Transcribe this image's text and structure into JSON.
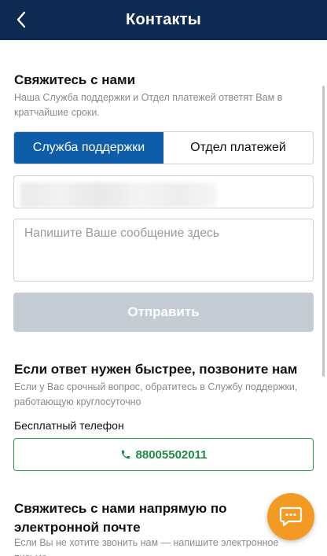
{
  "header": {
    "title": "Контакты",
    "back_icon": "chevron-left-icon"
  },
  "contact_form": {
    "title": "Свяжитесь с нами",
    "subtitle": "Наша Служба поддержки и Отдел платежей ответят Вам в кратчайшие сроки.",
    "tabs": [
      {
        "label": "Служба поддержки",
        "active": true
      },
      {
        "label": "Отдел платежей",
        "active": false
      }
    ],
    "message_placeholder": "Напишите Ваше сообщение здесь",
    "send_label": "Отправить"
  },
  "phone_section": {
    "title": "Если ответ нужен быстрее, позвоните нам",
    "subtitle": "Если у Вас срочный вопрос, обратитесь в Службу поддержки, работающую круглосуточно",
    "label": "Бесплатный телефон",
    "phone": "88005502011",
    "phone_icon": "phone-icon"
  },
  "email_section": {
    "title": "Свяжитесь с нами напрямую по электронной почте",
    "subtitle": "Если Вы не хотите звонить нам — напишите электронное письмо"
  },
  "chat": {
    "icon": "chat-bubble-icon"
  },
  "colors": {
    "header_bg": "#0d2a52",
    "tab_active": "#0f5da8",
    "send_disabled": "#c6ccd4",
    "phone_green": "#1f8a46",
    "chat_orange": "#f39a25"
  }
}
